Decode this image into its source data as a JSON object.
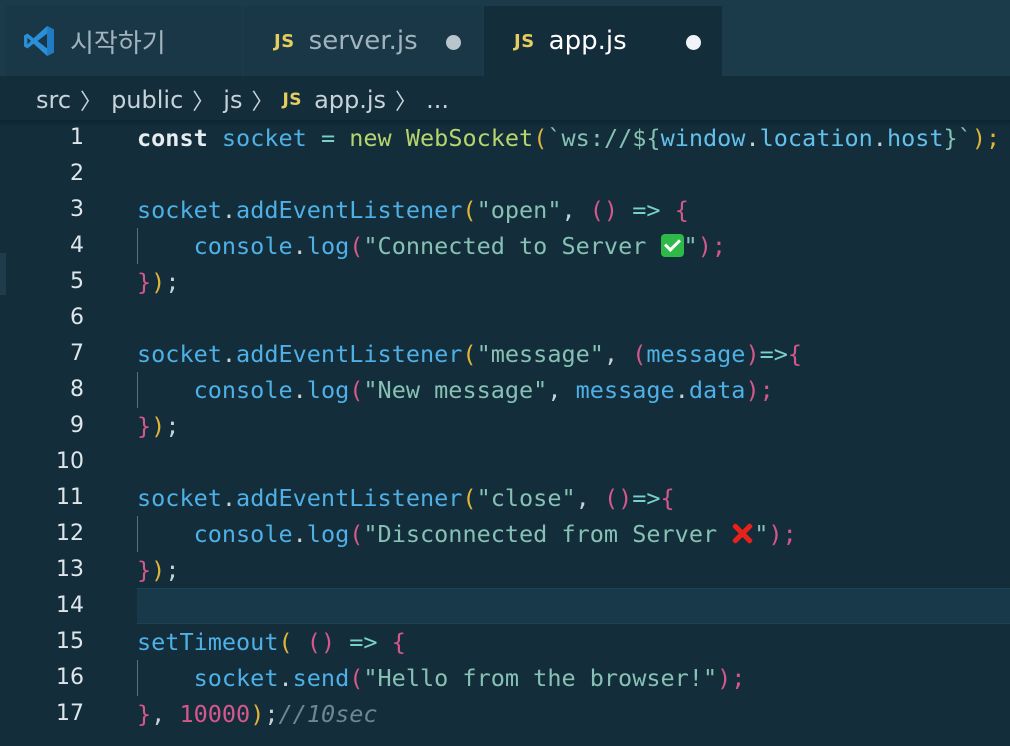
{
  "tabs": [
    {
      "label": "시작하기",
      "icon": "vscode-logo-icon",
      "active": false,
      "dirty": false
    },
    {
      "label": "server.js",
      "badge": "JS",
      "active": false,
      "dirty": true
    },
    {
      "label": "app.js",
      "badge": "JS",
      "active": true,
      "dirty": true
    }
  ],
  "breadcrumb": {
    "parts": [
      "src",
      "public",
      "js"
    ],
    "file_badge": "JS",
    "file": "app.js",
    "more": "..."
  },
  "cursor_line": 14,
  "line_numbers": [
    "1",
    "2",
    "3",
    "4",
    "5",
    "6",
    "7",
    "8",
    "9",
    "10",
    "11",
    "12",
    "13",
    "14",
    "15",
    "16",
    "17"
  ],
  "code": {
    "l1": {
      "kw": "const",
      "var": "socket",
      "op": "=",
      "new": "new",
      "cls": "WebSocket",
      "open": "(",
      "tpl_start": "`ws://${",
      "tpl_a": "window",
      "dot1": ".",
      "tpl_b": "location",
      "dot2": ".",
      "tpl_c": "host",
      "tpl_end": "}`",
      "close": ");"
    },
    "l3": {
      "obj": "socket",
      "dot": ".",
      "fn": "addEventListener",
      "open": "(",
      "str": "\"open\"",
      "comma": ",",
      "args": "()",
      "arrow": "=>",
      "brace": "{"
    },
    "l4": {
      "obj": "console",
      "dot": ".",
      "fn": "log",
      "open": "(",
      "str": "\"Connected to Server ",
      "str_end": "\"",
      "close": ");"
    },
    "l5": {
      "brace": "}",
      "paren": ")",
      "semi": ";"
    },
    "l7": {
      "obj": "socket",
      "dot": ".",
      "fn": "addEventListener",
      "open": "(",
      "str": "\"message\"",
      "comma": ",",
      "args_open": "(",
      "arg": "message",
      "args_close": ")",
      "arrow": "=>",
      "brace": "{"
    },
    "l8": {
      "obj": "console",
      "dot": ".",
      "fn": "log",
      "open": "(",
      "str": "\"New message\"",
      "comma": ",",
      "arg": "message",
      "dot2": ".",
      "prop": "data",
      "close": ");"
    },
    "l9": {
      "brace": "}",
      "paren": ")",
      "semi": ";"
    },
    "l11": {
      "obj": "socket",
      "dot": ".",
      "fn": "addEventListener",
      "open": "(",
      "str": "\"close\"",
      "comma": ",",
      "args": "()",
      "arrow": "=>",
      "brace": "{"
    },
    "l12": {
      "obj": "console",
      "dot": ".",
      "fn": "log",
      "open": "(",
      "str": "\"Disconnected from Server ",
      "str_end": "\"",
      "close": ");"
    },
    "l13": {
      "brace": "}",
      "paren": ")",
      "semi": ";"
    },
    "l15": {
      "fn": "setTimeout",
      "open": "(",
      "args": "()",
      "arrow": "=>",
      "brace": "{"
    },
    "l16": {
      "obj": "socket",
      "dot": ".",
      "fn": "send",
      "open": "(",
      "str": "\"Hello from the browser!\"",
      "close": ");"
    },
    "l17": {
      "brace": "}",
      "comma": ",",
      "num": "10000",
      "paren": ")",
      "semi": ";",
      "comment": "//10sec"
    }
  },
  "colors": {
    "background": "#132d3b",
    "keyword": "#e6ecef",
    "variable": "#4fb0e6",
    "function_class": "#b5d66d",
    "string": "#87c1b4",
    "number": "#d5588b",
    "bracket_level1": "#e1b43a",
    "bracket_level2": "#d5588b",
    "js_badge": "#e6cd5f"
  }
}
